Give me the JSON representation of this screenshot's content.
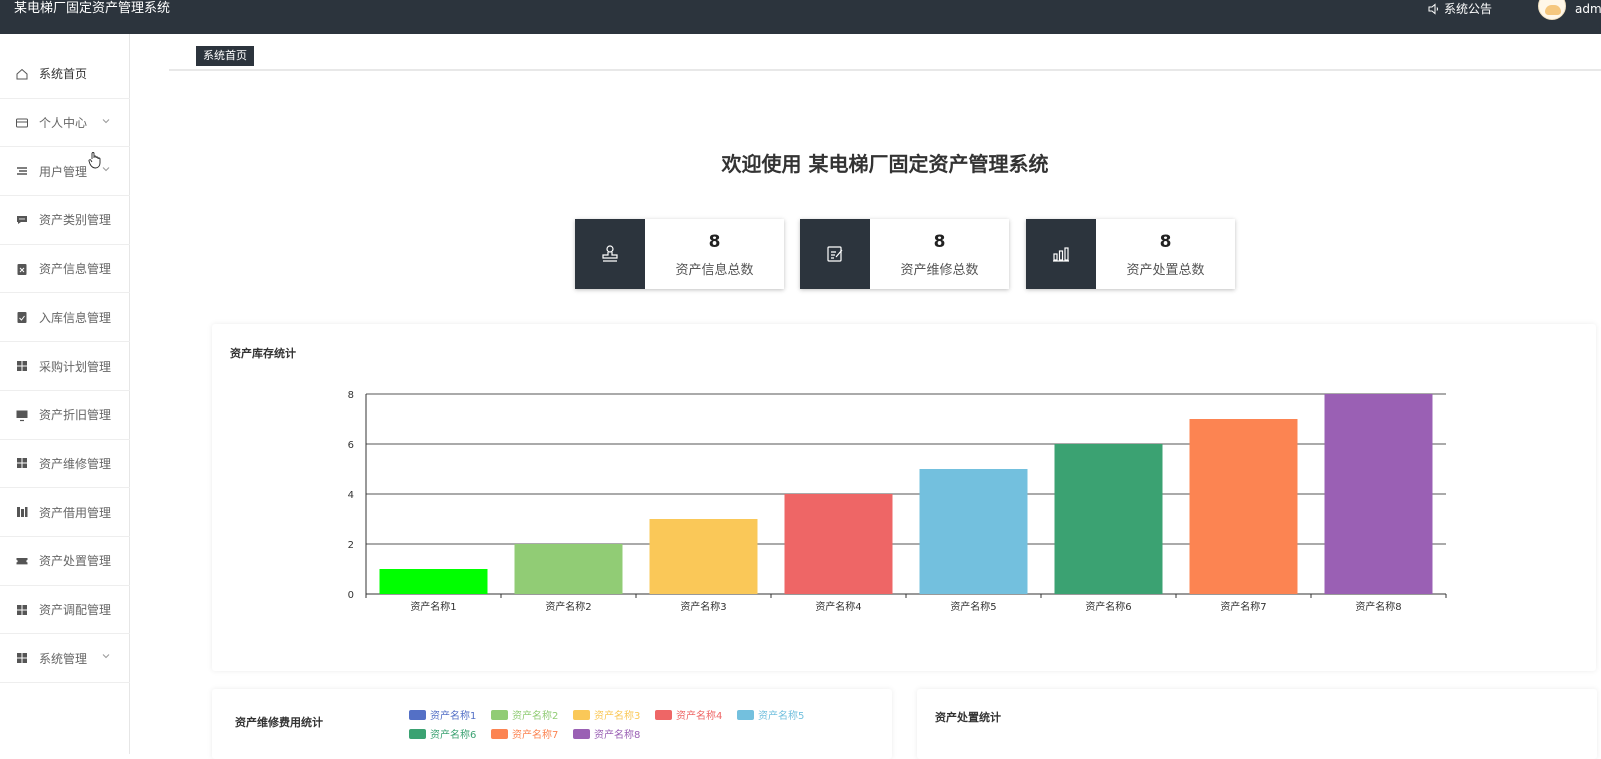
{
  "header": {
    "app_title": "某电梯厂固定资产管理系统",
    "notice_label": "系统公告",
    "user_label": "adm"
  },
  "sidebar": {
    "items": [
      {
        "label": "系统首页",
        "icon": "home-icon",
        "expandable": false
      },
      {
        "label": "个人中心",
        "icon": "card-icon",
        "expandable": true
      },
      {
        "label": "用户管理",
        "icon": "list-icon",
        "expandable": true
      },
      {
        "label": "资产类别管理",
        "icon": "chat-icon",
        "expandable": false
      },
      {
        "label": "资产信息管理",
        "icon": "clipboard-x-icon",
        "expandable": false
      },
      {
        "label": "入库信息管理",
        "icon": "clipboard-check-icon",
        "expandable": false
      },
      {
        "label": "采购计划管理",
        "icon": "grid-icon",
        "expandable": false
      },
      {
        "label": "资产折旧管理",
        "icon": "monitor-icon",
        "expandable": false
      },
      {
        "label": "资产维修管理",
        "icon": "grid-icon",
        "expandable": false
      },
      {
        "label": "资产借用管理",
        "icon": "columns-icon",
        "expandable": false
      },
      {
        "label": "资产处置管理",
        "icon": "ticket-icon",
        "expandable": false
      },
      {
        "label": "资产调配管理",
        "icon": "grid-icon",
        "expandable": false
      },
      {
        "label": "系统管理",
        "icon": "grid-icon",
        "expandable": true
      }
    ]
  },
  "breadcrumb": {
    "current": "系统首页"
  },
  "welcome": "欢迎使用 某电梯厂固定资产管理系统",
  "stats": [
    {
      "value": "8",
      "label": "资产信息总数",
      "icon": "stamp-icon"
    },
    {
      "value": "8",
      "label": "资产维修总数",
      "icon": "edit-doc-icon"
    },
    {
      "value": "8",
      "label": "资产处置总数",
      "icon": "bar-chart-icon"
    }
  ],
  "panels": {
    "inventory_title": "资产库存统计",
    "repair_cost_title": "资产维修费用统计",
    "disposal_title": "资产处置统计"
  },
  "colors": [
    "#00ff00",
    "#91cc75",
    "#fac858",
    "#ee6666",
    "#73c0de",
    "#3ba272",
    "#fc8452",
    "#9a60b4"
  ],
  "legend_colors": [
    "#5470c6",
    "#91cc75",
    "#fac858",
    "#ee6666",
    "#73c0de",
    "#3ba272",
    "#fc8452",
    "#9a60b4"
  ],
  "chart_data": {
    "type": "bar",
    "title": "资产库存统计",
    "categories": [
      "资产名称1",
      "资产名称2",
      "资产名称3",
      "资产名称4",
      "资产名称5",
      "资产名称6",
      "资产名称7",
      "资产名称8"
    ],
    "values": [
      1,
      2,
      3,
      4,
      5,
      6,
      7,
      8
    ],
    "ylim": [
      0,
      8
    ],
    "yticks": [
      0,
      2,
      4,
      6,
      8
    ],
    "grid": true
  },
  "legend": [
    "资产名称1",
    "资产名称2",
    "资产名称3",
    "资产名称4",
    "资产名称5",
    "资产名称6",
    "资产名称7",
    "资产名称8"
  ]
}
